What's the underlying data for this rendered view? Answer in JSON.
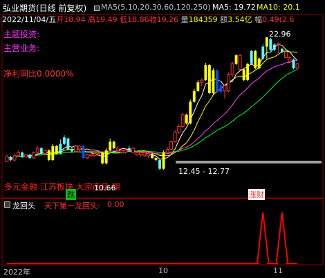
{
  "header": {
    "title": "弘业期货(日线 前复权)",
    "ma_label": "MA5(5,10,20,30,60,120,250)",
    "ma5": "MA5: 19.72",
    "ma10": "MA10: 20.1",
    "colors": {
      "title": "#ffffff",
      "ma5": "#ffffff",
      "ma10": "#ffff00",
      "ma_params": "#c0c0c0"
    }
  },
  "info_line": {
    "date": "2022/11/04/五",
    "open_label": "开",
    "open": "18.94",
    "high_label": "高",
    "high": "19.49",
    "low_label": "低",
    "low": "18.86",
    "close_label": "收",
    "close": "19.26",
    "vol_label": "量",
    "vol": "184359",
    "amt_label": "额",
    "amt": "3.54亿",
    "chg_label": "幅",
    "chg": "0.49(2.6"
  },
  "overlays": {
    "theme_label": "主题投资:",
    "business_label": "主营业务:",
    "profit_label": "净利同比0.0000%",
    "tags_text": "多元金融 江苏板块 大宗商品 期",
    "tag_die": "跌",
    "tag_caibao": "涨财"
  },
  "price_marks": {
    "high": "22.96",
    "low": "10.66",
    "range": "12.45 - 12.77"
  },
  "indicator": {
    "name": "龙回头",
    "label": "天下第一龙回头:",
    "value": "0.00",
    "icon": "checkbox-icon",
    "signal_color": "#ff0000"
  },
  "x_axis": {
    "year_label": "2022年",
    "oct": "10",
    "nov": "11"
  },
  "chart_data": {
    "type": "candlestick",
    "ylim": [
      9.5,
      24.5
    ],
    "x": [
      1,
      2,
      3,
      4,
      5,
      6,
      7,
      8,
      9,
      10,
      11,
      12,
      13,
      14,
      15,
      16,
      17,
      18,
      19,
      20,
      21,
      22,
      23,
      24,
      25,
      26,
      27,
      28,
      29,
      30,
      31,
      32,
      33,
      34,
      35,
      36,
      37,
      38,
      39,
      40,
      41,
      42,
      43,
      44,
      45,
      46,
      47,
      48,
      49,
      50,
      51,
      52,
      53,
      54,
      55,
      56,
      57,
      58,
      59,
      60,
      61,
      62,
      63,
      64,
      65,
      66,
      67,
      68,
      69,
      70,
      71,
      72,
      73,
      74,
      75,
      76,
      77,
      78,
      79,
      80,
      81,
      82,
      83,
      84,
      85,
      86,
      87,
      88,
      89,
      90,
      91,
      92,
      93,
      94,
      95,
      96
    ],
    "candles": [
      [
        "red",
        11.5,
        11.9,
        11.4,
        12.1
      ],
      [
        "cyan",
        11.9,
        11.6,
        11.5,
        12.0
      ],
      [
        "red",
        11.6,
        12.0,
        11.5,
        12.2
      ],
      [
        "red",
        12.0,
        12.3,
        11.9,
        12.5
      ],
      [
        "cyan",
        12.3,
        11.9,
        11.8,
        12.4
      ],
      [
        "red",
        11.9,
        12.1,
        11.8,
        12.2
      ],
      [
        "cyan",
        12.1,
        11.8,
        11.7,
        12.2
      ],
      [
        "red",
        11.8,
        12.3,
        11.7,
        12.4
      ],
      [
        "red",
        12.3,
        12.7,
        12.2,
        12.9
      ],
      [
        "cyan",
        12.7,
        12.2,
        12.1,
        12.8
      ],
      [
        "red",
        12.2,
        12.5,
        12.1,
        12.6
      ],
      [
        "yellow",
        12.5,
        11.6,
        11.5,
        12.6
      ],
      [
        "yellow",
        11.6,
        12.9,
        11.5,
        13.1
      ],
      [
        "yellow",
        12.9,
        12.2,
        12.1,
        13.0
      ],
      [
        "cyan",
        12.2,
        13.1,
        12.1,
        13.5
      ],
      [
        "cyan",
        13.1,
        13.7,
        13.0,
        13.9
      ],
      [
        "cyan",
        13.6,
        12.6,
        12.5,
        13.7
      ],
      [
        "cyan",
        12.6,
        12.4,
        12.3,
        12.8
      ],
      [
        "red",
        12.4,
        12.9,
        12.3,
        13.0
      ],
      [
        "red",
        12.9,
        12.6,
        12.4,
        13.0
      ],
      [
        "blue",
        12.9,
        11.8,
        11.7,
        13.0
      ],
      [
        "red",
        11.8,
        12.1,
        11.7,
        12.2
      ],
      [
        "red",
        12.1,
        12.0,
        11.9,
        12.3
      ],
      [
        "red",
        12.0,
        12.2,
        11.9,
        12.3
      ],
      [
        "red",
        12.2,
        12.1,
        12.0,
        12.3
      ],
      [
        "yellow",
        12.3,
        11.3,
        11.2,
        12.4
      ],
      [
        "yellow",
        11.3,
        12.5,
        11.2,
        12.7
      ],
      [
        "yellow",
        12.5,
        13.3,
        12.4,
        13.6
      ],
      [
        "yellow",
        13.3,
        12.7,
        12.6,
        13.4
      ],
      [
        "red",
        12.7,
        12.5,
        12.4,
        12.9
      ],
      [
        "red",
        12.5,
        12.3,
        12.2,
        12.7
      ],
      [
        "red",
        12.3,
        12.5,
        12.2,
        12.7
      ],
      [
        "cyan",
        12.5,
        12.7,
        12.4,
        12.9
      ],
      [
        "red",
        12.7,
        12.3,
        12.2,
        12.8
      ],
      [
        "red",
        12.3,
        12.1,
        12.0,
        12.4
      ],
      [
        "red",
        12.1,
        12.3,
        11.9,
        12.4
      ],
      [
        "red",
        12.3,
        12.0,
        11.9,
        12.4
      ],
      [
        "red",
        12.0,
        12.2,
        11.8,
        12.3
      ],
      [
        "yellow",
        12.2,
        11.8,
        11.7,
        12.3
      ],
      [
        "yellow",
        11.8,
        11.6,
        11.5,
        11.9
      ],
      [
        "cyan",
        11.6,
        10.8,
        10.66,
        11.7
      ],
      [
        "yellow",
        10.8,
        12.3,
        10.7,
        12.5
      ],
      [
        "red",
        12.3,
        12.6,
        12.2,
        12.8
      ],
      [
        "red",
        12.6,
        13.3,
        12.5,
        13.4
      ],
      [
        "red",
        13.3,
        14.2,
        13.2,
        14.4
      ],
      [
        "red",
        14.2,
        14.7,
        14.0,
        14.9
      ],
      [
        "red",
        14.7,
        15.8,
        14.6,
        16.0
      ],
      [
        "yellow",
        15.8,
        15.0,
        14.9,
        15.9
      ],
      [
        "yellow",
        15.0,
        17.0,
        14.9,
        17.2
      ],
      [
        "yellow",
        17.0,
        18.0,
        16.9,
        18.2
      ],
      [
        "yellow",
        18.0,
        18.8,
        17.9,
        19.0
      ],
      [
        "red",
        18.8,
        19.0,
        18.4,
        19.2
      ],
      [
        "yellow",
        19.0,
        20.4,
        18.9,
        20.6
      ],
      [
        "yellow",
        20.4,
        17.8,
        17.7,
        20.5
      ],
      [
        "yellow",
        17.8,
        19.9,
        17.7,
        20.1
      ],
      [
        "blue",
        19.9,
        17.9,
        17.8,
        20.0
      ],
      [
        "blue",
        17.9,
        18.5,
        17.8,
        18.7
      ],
      [
        "red",
        18.5,
        18.0,
        17.3,
        18.6
      ],
      [
        "red",
        18.0,
        19.5,
        17.9,
        19.7
      ],
      [
        "red",
        19.5,
        20.5,
        19.3,
        20.7
      ],
      [
        "yellow",
        20.5,
        21.3,
        20.4,
        21.4
      ],
      [
        "red",
        21.3,
        20.0,
        19.9,
        21.4
      ],
      [
        "yellow",
        20.0,
        19.0,
        18.9,
        20.1
      ],
      [
        "yellow",
        19.0,
        20.5,
        18.9,
        20.6
      ],
      [
        "cyan",
        20.5,
        21.7,
        20.4,
        21.8
      ],
      [
        "yellow",
        21.7,
        20.1,
        20.0,
        21.8
      ],
      [
        "yellow",
        20.1,
        21.0,
        20.0,
        21.1
      ],
      [
        "cyan",
        21.0,
        22.1,
        20.9,
        22.3
      ],
      [
        "yellow",
        22.1,
        22.96,
        21.0,
        22.96
      ],
      [
        "cyan",
        22.8,
        21.8,
        21.7,
        22.9
      ],
      [
        "cyan",
        21.8,
        22.3,
        21.7,
        22.4
      ],
      [
        "red",
        22.3,
        22.4,
        21.5,
        22.5
      ],
      [
        "cyan",
        21.9,
        21.6,
        21.5,
        22.0
      ],
      [
        "red",
        21.6,
        21.1,
        21.0,
        21.7
      ],
      [
        "red",
        21.1,
        20.7,
        20.6,
        21.2
      ],
      [
        "cyan",
        20.9,
        20.1,
        20.0,
        21.0
      ],
      [
        "red",
        20.1,
        20.5,
        20.0,
        20.6
      ]
    ],
    "signal_days": [
      67,
      72
    ]
  }
}
